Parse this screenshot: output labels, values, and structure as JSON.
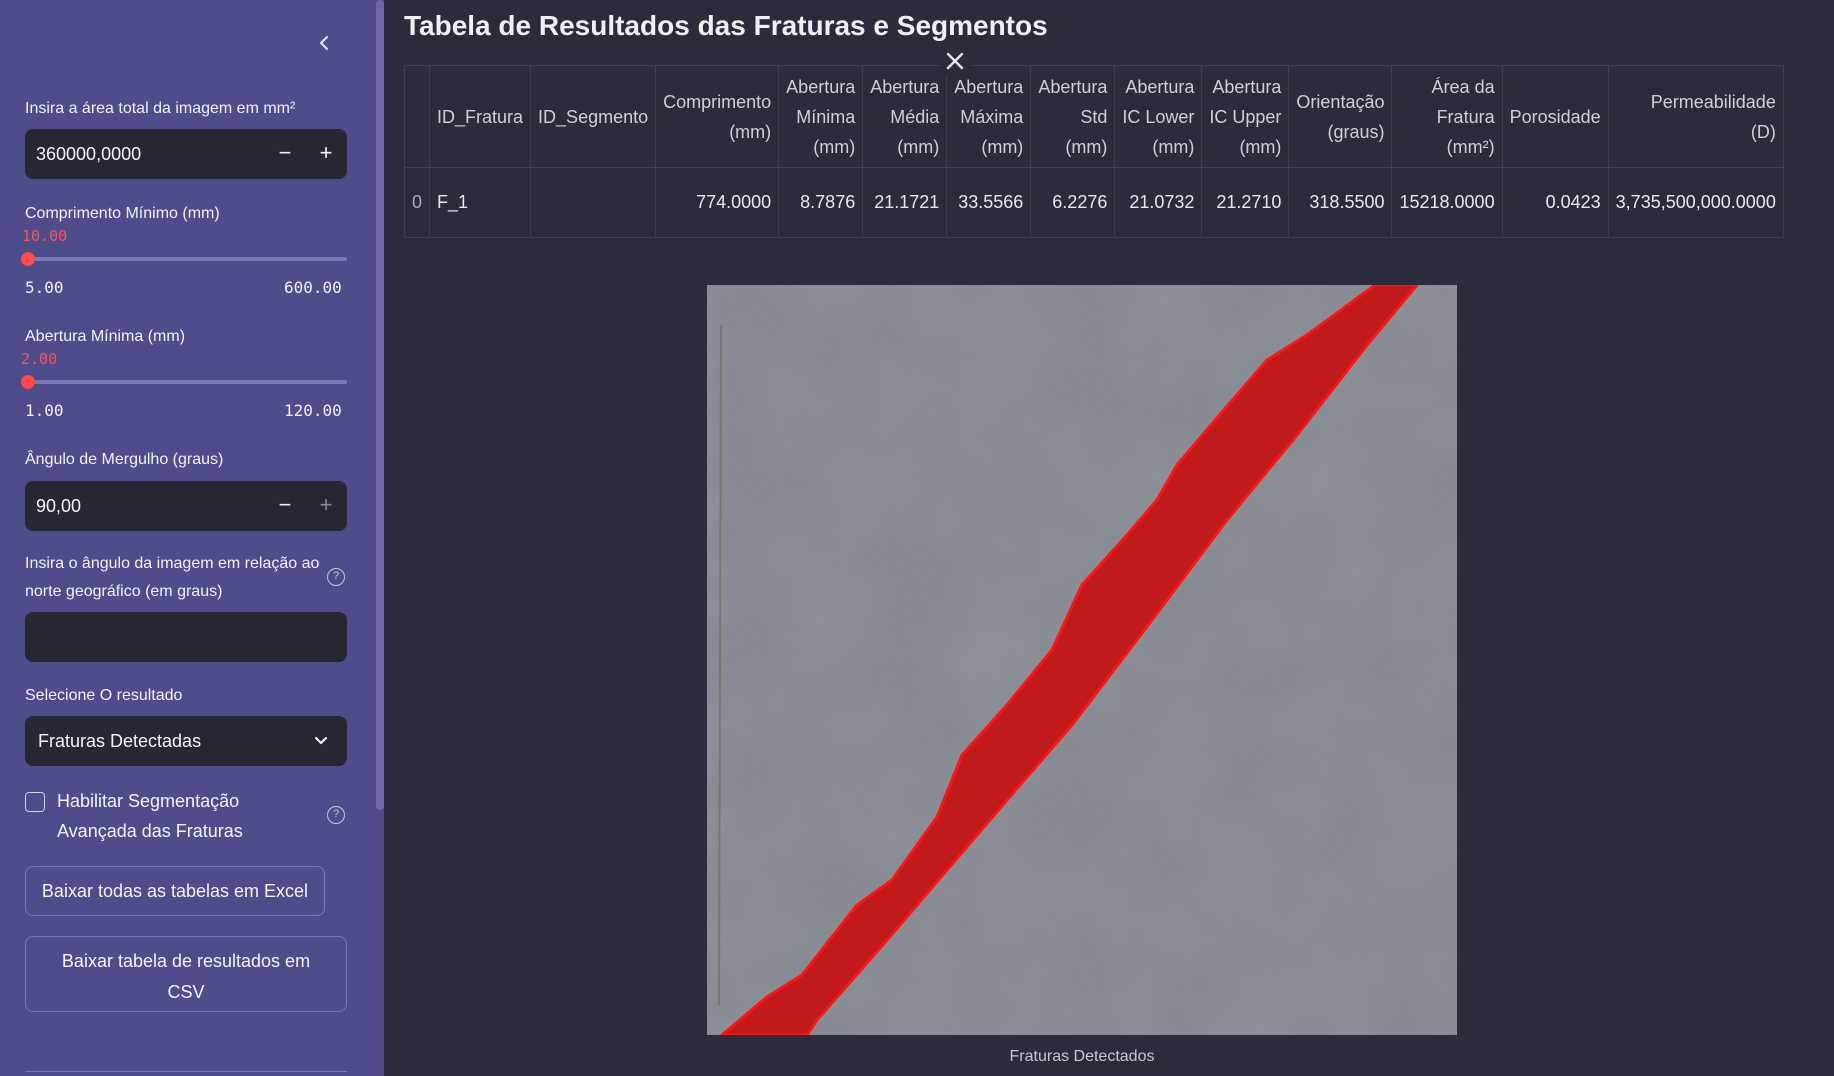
{
  "sidebar": {
    "area_label": "Insira a área total da imagem em mm²",
    "area_value": "360000,0000",
    "comp_label": "Comprimento Mínimo (mm)",
    "comp_value": "10.00",
    "comp_min": "5.00",
    "comp_max": "600.00",
    "comp_fraction": 0.0084,
    "abert_label": "Abertura Mínima (mm)",
    "abert_value": "2.00",
    "abert_min": "1.00",
    "abert_max": "120.00",
    "abert_fraction": 0.0084,
    "mergulho_label": "Ângulo de Mergulho (graus)",
    "mergulho_value": "90,00",
    "norte_label_1": "Insira o ângulo da imagem em relação ao",
    "norte_label_2": "norte geográfico (em graus)",
    "norte_value": "",
    "select_label": "Selecione O resultado",
    "select_value": "Fraturas Detectadas",
    "checkbox_label_1": "Habilitar Segmentação",
    "checkbox_label_2": "Avançada das Fraturas",
    "checkbox_checked": false,
    "excel_button": "Baixar todas as tabelas em Excel",
    "csv_button_1": "Baixar tabela de resultados em",
    "csv_button_2": "CSV",
    "help_glyph": "?",
    "minus_glyph": "−",
    "plus_glyph": "+"
  },
  "main": {
    "title": "Tabela de Resultados das Fraturas e Segmentos",
    "columns": [
      [
        "",
        ""
      ],
      [
        "ID_Fratura"
      ],
      [
        "ID_Segmento"
      ],
      [
        "Comprimento",
        "(mm)"
      ],
      [
        "Abertura",
        "Mínima",
        "(mm)"
      ],
      [
        "Abertura",
        "Média",
        "(mm)"
      ],
      [
        "Abertura",
        "Máxima",
        "(mm)"
      ],
      [
        "Abertura",
        "Std",
        "(mm)"
      ],
      [
        "Abertura",
        "IC Lower",
        "(mm)"
      ],
      [
        "Abertura",
        "IC Upper",
        "(mm)"
      ],
      [
        "Orientação",
        "(graus)"
      ],
      [
        "Área da",
        "Fratura",
        "(mm²)"
      ],
      [
        "Porosidade"
      ],
      [
        "Permeabilidade",
        "(D)"
      ]
    ],
    "rows": [
      [
        "0",
        "F_1",
        "",
        "774.0000",
        "8.7876",
        "21.1721",
        "33.5566",
        "6.2276",
        "21.0732",
        "21.2710",
        "318.5500",
        "15218.0000",
        "0.0423",
        "3,735,500,000.0000"
      ]
    ],
    "image_caption": "Fraturas Detectados",
    "colors": {
      "sidebar_bg": "#4d4d8c",
      "main_bg": "#2a2c3b",
      "accent": "#ff4b4b",
      "fracture": "#e01010"
    }
  }
}
